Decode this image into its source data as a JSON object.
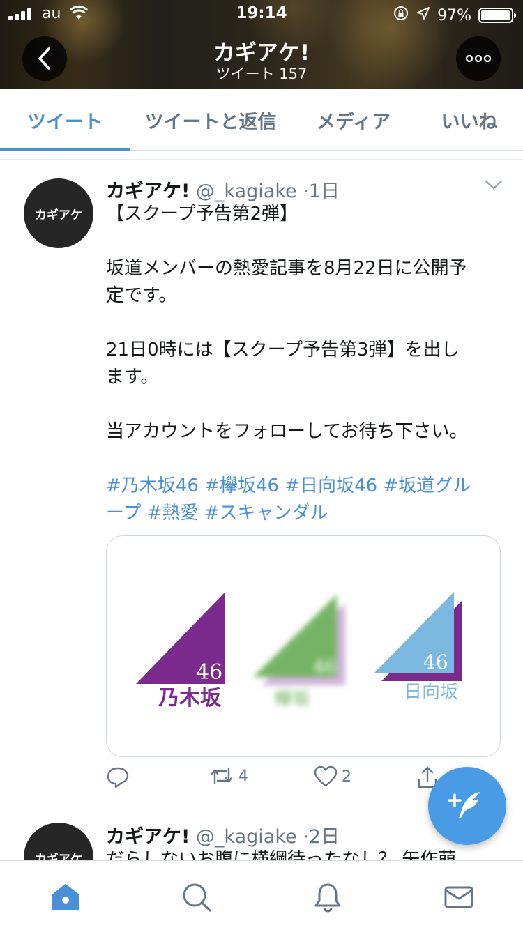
{
  "status_bar": {
    "carrier": "au",
    "time": "19:14",
    "battery": "97%",
    "battery_level": 0.97
  },
  "header": {
    "title": "カギアケ!",
    "subtitle": "ツイート 157"
  },
  "tabs": [
    {
      "label": "ツイート",
      "active": true
    },
    {
      "label": "ツイートと返信",
      "active": false
    },
    {
      "label": "メディア",
      "active": false
    },
    {
      "label": "いいね",
      "active": false
    }
  ],
  "tweets": [
    {
      "avatar_text": "カギアケ",
      "name": "カギアケ!",
      "handle": "@_kagiake",
      "time": "1日",
      "lines": [
        "【スクープ予告第2弾】",
        "",
        "坂道メンバーの熱愛記事を8月22日に公開予",
        "定です。",
        "",
        "21日0時には【スクープ予告第3弾】を出し",
        "ます。",
        "",
        "当アカウントをフォローしてお待ち下さい。",
        ""
      ],
      "hashtag_lines": [
        "#乃木坂46 #欅坂46 #日向坂46 #坂道グル",
        "ープ #熱愛 #スキャンダル"
      ],
      "media": [
        {
          "number": "46",
          "label": "乃木坂",
          "color": "#7b2a8e"
        },
        {
          "number": "46",
          "label": "欅坂",
          "color": "#5ea84a"
        },
        {
          "number": "46",
          "label": "日向坂",
          "color": "#7ab8e0"
        }
      ],
      "retweets": "4",
      "likes": "2"
    },
    {
      "avatar_text": "カギアケ",
      "name": "カギアケ!",
      "handle": "@_kagiake",
      "time": "2日",
      "preview_text": "だらしないお腹に横綱待ったなし？ 矢作萌"
    }
  ],
  "colors": {
    "accent": "#4a90d9",
    "secondary_text": "#657786",
    "fab": "#4a9be6"
  },
  "icons": {
    "back": "chevron-left-icon",
    "more": "ellipsis-icon",
    "reply": "speech-bubble-icon",
    "retweet": "retweet-icon",
    "like": "heart-icon",
    "share": "share-icon",
    "compose": "compose-feather-icon",
    "home": "home-icon",
    "search": "search-icon",
    "notifications": "bell-icon",
    "messages": "envelope-icon"
  }
}
